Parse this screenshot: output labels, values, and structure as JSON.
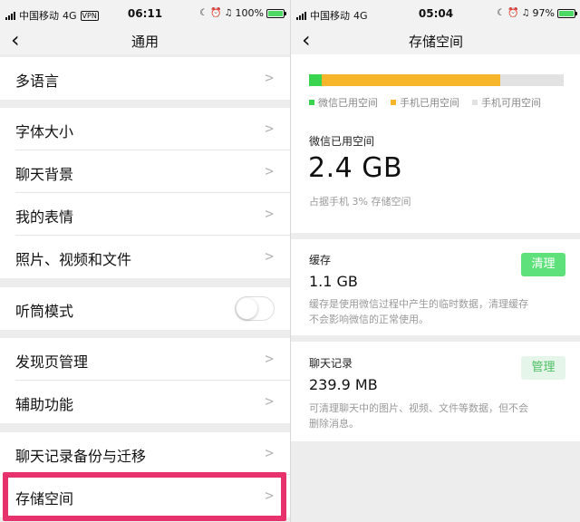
{
  "colors": {
    "wechat_used": "#3ad450",
    "phone_used": "#f6b52b",
    "phone_free": "#e2e2e2",
    "highlight": "#e8326e",
    "clean_button": "#5ee07a",
    "manage_button_bg": "#e6f5e9",
    "manage_button_text": "#4bbf63"
  },
  "left": {
    "status": {
      "carrier": "中国移动",
      "network": "4G",
      "vpn": "VPN",
      "time": "06:11",
      "battery": "100%",
      "battery_level": 1.0
    },
    "nav": {
      "back_icon": "chevron-left",
      "title": "通用"
    },
    "items": [
      {
        "label": "多语言"
      },
      {
        "label": "字体大小"
      },
      {
        "label": "聊天背景"
      },
      {
        "label": "我的表情"
      },
      {
        "label": "照片、视频和文件"
      },
      {
        "label": "听筒模式",
        "toggle": false
      },
      {
        "label": "发现页管理"
      },
      {
        "label": "辅助功能"
      },
      {
        "label": "聊天记录备份与迁移"
      },
      {
        "label": "存储空间"
      }
    ]
  },
  "right": {
    "status": {
      "carrier": "中国移动",
      "network": "4G",
      "time": "05:04",
      "battery": "97%",
      "battery_level": 0.97
    },
    "nav": {
      "back_icon": "chevron-left",
      "title": "存储空间"
    },
    "usage": {
      "wechat_fraction": 0.05,
      "phone_fraction": 0.7,
      "legend": [
        "微信已用空间",
        "手机已用空间",
        "手机可用空间"
      ]
    },
    "summary": {
      "label": "微信已用空间",
      "value": "2.4 GB",
      "note": "占据手机 3% 存储空间"
    },
    "cache": {
      "title": "缓存",
      "value": "1.1 GB",
      "desc_line1": "缓存是使用微信过程中产生的临时数据，清理缓存",
      "desc_line2": "不会影响微信的正常使用。",
      "button": "清理"
    },
    "chats": {
      "title": "聊天记录",
      "value": "239.9 MB",
      "desc_line1": "可清理聊天中的图片、视频、文件等数据，但不会",
      "desc_line2": "删除消息。",
      "button": "管理"
    }
  }
}
